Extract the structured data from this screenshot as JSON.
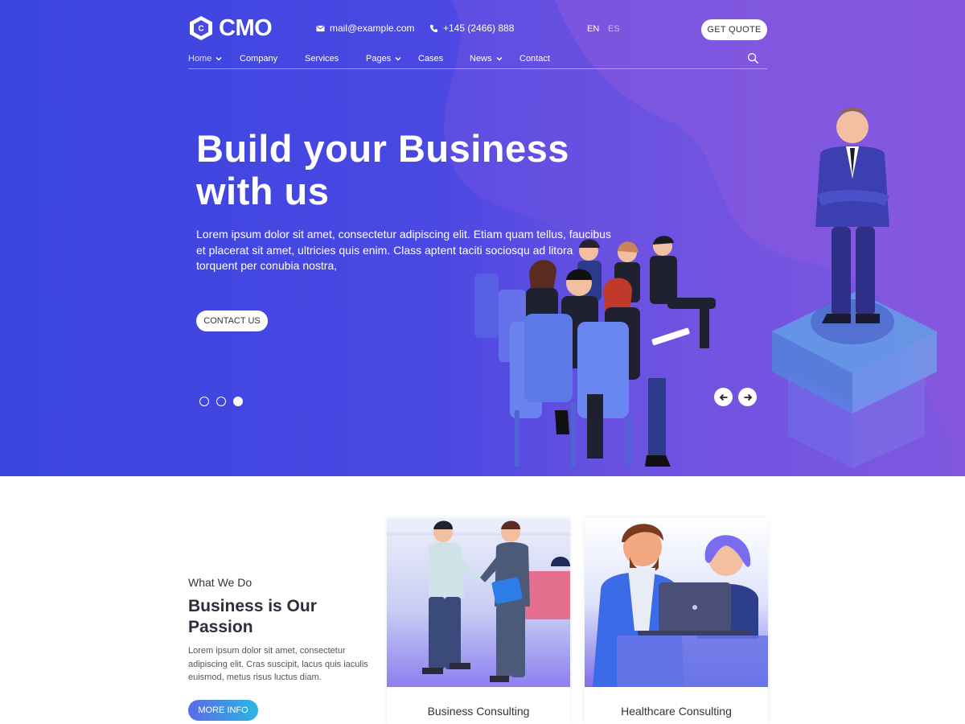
{
  "brand": {
    "name": "CMO"
  },
  "header": {
    "email": "mail@example.com",
    "phone": "+145 (2466) 888",
    "languages": [
      "EN",
      "ES"
    ],
    "quote_label": "GET QUOTE"
  },
  "nav": {
    "items": [
      {
        "label": "Home",
        "dropdown": true,
        "active": true
      },
      {
        "label": "Company",
        "dropdown": false
      },
      {
        "label": "Services",
        "dropdown": false
      },
      {
        "label": "Pages",
        "dropdown": true
      },
      {
        "label": "Cases",
        "dropdown": false
      },
      {
        "label": "News",
        "dropdown": true
      },
      {
        "label": "Contact",
        "dropdown": false
      }
    ]
  },
  "hero": {
    "title": "Build your Business with us",
    "text": "Lorem ipsum dolor sit amet, consectetur adipiscing elit. Etiam quam tellus, faucibus et placerat sit amet, ultricies quis enim. Class aptent taciti sociosqu ad litora torquent per conubia nostra,",
    "cta_label": "CONTACT US",
    "slides_total": 3,
    "slide_active": 3
  },
  "what_we_do": {
    "subtitle": "What We Do",
    "title": "Business is Our Passion",
    "text": "Lorem ipsum dolor sit amet, consectetur adipiscing elit. Cras suscipit, lacus quis iaculis euismod, metus risus luctus diam.",
    "button_label": "MORE INFO"
  },
  "cards": [
    {
      "title": "Business Consulting"
    },
    {
      "title": "Healthcare Consulting"
    }
  ],
  "colors": {
    "hero_start": "#3a45e0",
    "hero_end": "#9b5fdc",
    "button_gradient_start": "#5a6be8",
    "button_gradient_end": "#2bb6e0",
    "title_dark": "#2b2f3d"
  },
  "icons": [
    "logo-cube-icon",
    "mail-icon",
    "phone-icon",
    "chevron-down-icon",
    "search-icon",
    "arrow-left-icon",
    "arrow-right-icon"
  ]
}
